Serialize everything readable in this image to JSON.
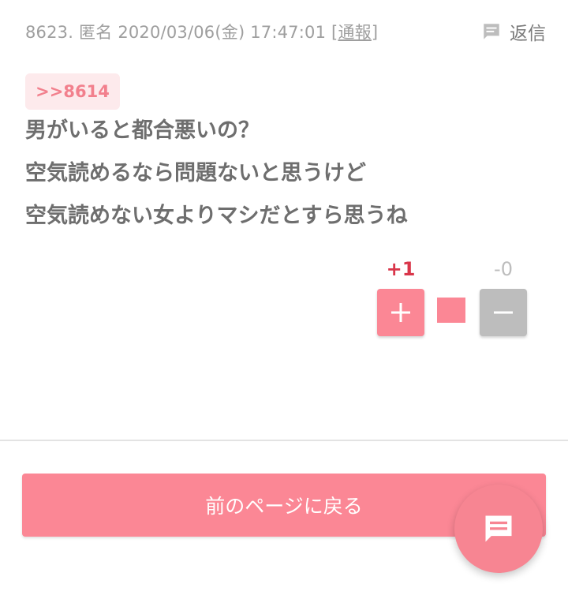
{
  "post": {
    "number": "8623.",
    "author": "匿名",
    "timestamp": "2020/03/06(金) 17:47:01",
    "report_label": "通報",
    "reply_label": "返信",
    "anchor": ">>8614",
    "lines": [
      "男がいると都合悪いの？",
      "空気読めるなら問題ないと思うけど",
      "空気読めない女よりマシだとすら思うね"
    ]
  },
  "votes": {
    "plus_count": "+1",
    "minus_count": "-0",
    "plus_ratio": 1.0
  },
  "footer": {
    "back_label": "前のページに戻る"
  },
  "colors": {
    "accent": "#fb8795",
    "plus_count": "#d9364a",
    "neutral": "#bdbdbd"
  },
  "icons": {
    "reply": "comment-icon",
    "fab": "chat-icon"
  }
}
